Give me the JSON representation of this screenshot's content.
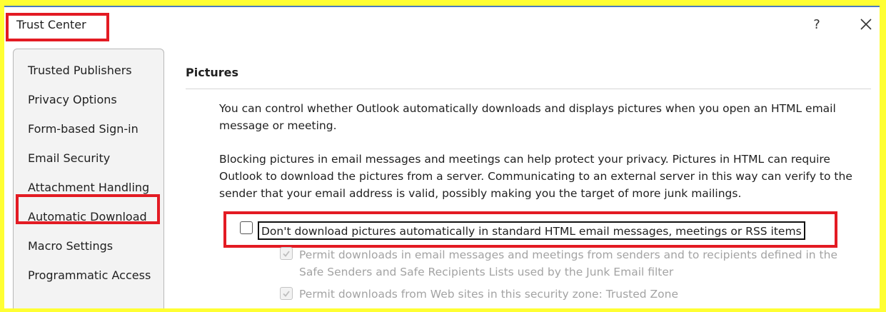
{
  "dialog": {
    "title": "Trust Center",
    "help_label": "?",
    "close_icon": "close-icon"
  },
  "sidebar": {
    "items": [
      {
        "label": "Trusted Publishers"
      },
      {
        "label": "Privacy Options"
      },
      {
        "label": "Form-based Sign-in"
      },
      {
        "label": "Email Security"
      },
      {
        "label": "Attachment Handling"
      },
      {
        "label": "Automatic Download",
        "selected": true
      },
      {
        "label": "Macro Settings"
      },
      {
        "label": "Programmatic Access"
      }
    ]
  },
  "main": {
    "heading": "Pictures",
    "paragraph1": "You can control whether Outlook automatically downloads and displays pictures when you open an HTML email message or meeting.",
    "paragraph2": "Blocking pictures in email messages and meetings can help protect your privacy. Pictures in HTML can require Outlook to download the pictures from a server. Communicating to an external server in this way can verify to the sender that your email address is valid, possibly making you the target of more junk mailings.",
    "options": {
      "dont_download": {
        "label": "Don't download pictures automatically in standard HTML email messages, meetings or RSS items",
        "checked": false
      },
      "permit_safe_senders": {
        "label": "Permit downloads in email messages and meetings from senders and to recipients defined in the Safe Senders and Safe Recipients Lists used by the Junk Email filter",
        "checked": true,
        "disabled": true
      },
      "permit_trusted_zone": {
        "label": "Permit downloads from Web sites in this security zone: Trusted Zone",
        "checked": true,
        "disabled": true
      }
    }
  },
  "colors": {
    "highlight": "#e31b23",
    "background": "#ffff33",
    "disabled_text": "#a3a3a3"
  }
}
